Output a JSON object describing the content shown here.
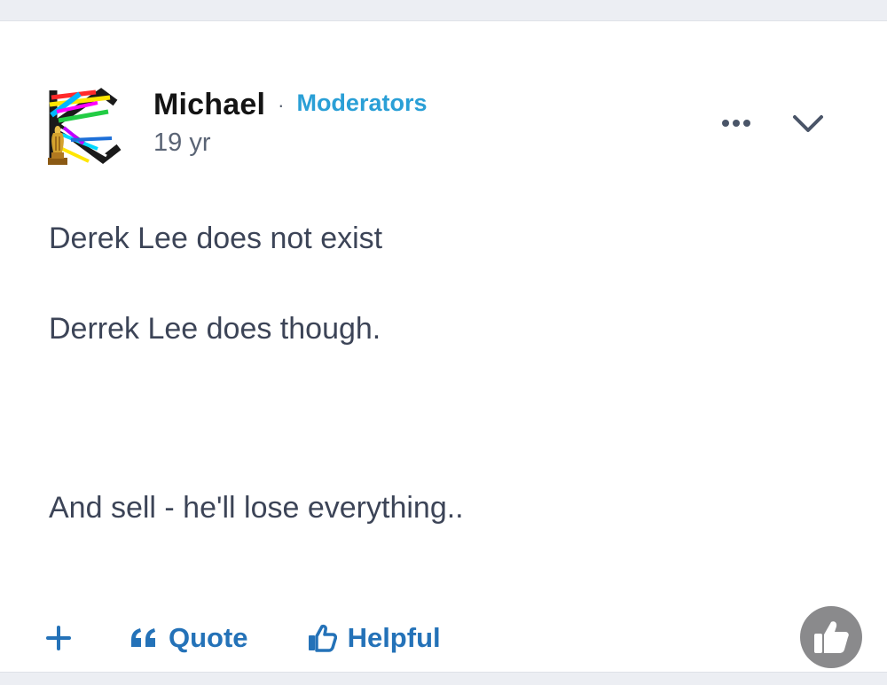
{
  "post": {
    "author": {
      "name": "Michael",
      "separator": "·",
      "role": "Moderators",
      "avatar_icon": "avatar-k-logo-with-trophy"
    },
    "timestamp": "19 yr",
    "menu": {
      "more_icon": "ellipsis-icon",
      "collapse_icon": "chevron-down-icon"
    },
    "body": {
      "paragraph_1": "Derek Lee does not exist",
      "paragraph_2": "Derrek Lee does though.",
      "paragraph_3": "And sell - he'll lose everything.."
    },
    "actions": {
      "add_icon": "plus-icon",
      "quote_label": "Quote",
      "quote_icon": "quote-icon",
      "helpful_label": "Helpful",
      "helpful_icon": "thumbs-up-outline-icon",
      "reaction_icon": "thumbs-up-filled-icon"
    }
  },
  "colors": {
    "role": "#2a9fd6",
    "action": "#2472b8",
    "body_text": "#3c4457",
    "reaction_bg": "#8a8a8c"
  }
}
